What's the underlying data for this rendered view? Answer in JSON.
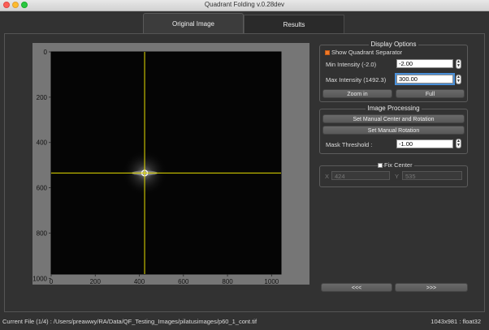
{
  "window": {
    "title": "Quadrant Folding v.0.28dev"
  },
  "tabs": [
    {
      "label": "Original Image",
      "active": true
    },
    {
      "label": "Results",
      "active": false
    }
  ],
  "display_options": {
    "title": "Display Options",
    "show_quadrant_separator": {
      "label": "Show Quadrant Separator",
      "checked": true
    },
    "min_intensity": {
      "label": "Min Intensity (-2.0)",
      "value": "-2.00"
    },
    "max_intensity": {
      "label": "Max Intensity (1492.3)",
      "value": "300.00"
    },
    "zoom_in_label": "Zoom in",
    "full_label": "Full"
  },
  "image_processing": {
    "title": "Image Processing",
    "set_center_rotation_label": "Set Manual Center and Rotation",
    "set_rotation_label": "Set Manual Rotation",
    "mask_threshold": {
      "label": "Mask Threshold :",
      "value": "-1.00"
    }
  },
  "fix_center": {
    "label": "Fix Center",
    "checked": false,
    "x_label": "X",
    "x_value": "424",
    "y_label": "Y",
    "y_value": "535"
  },
  "navigation": {
    "prev_label": "<<<",
    "next_label": ">>>"
  },
  "status": {
    "current_file": "Current File (1/4) : /Users/preawwy/RA/Data/QF_Testing_Images/pilatusimages/p60_1_cont.tif",
    "image_info": "1043x981 : float32"
  },
  "colors": {
    "separator_line": "#e8e000",
    "checkbox_checked": "#f07a2a",
    "focus_ring": "#4a90d9"
  },
  "image_plot": {
    "x_ticks": [
      0,
      200,
      400,
      600,
      800,
      1000
    ],
    "y_ticks": [
      0,
      200,
      400,
      600,
      800,
      1000
    ],
    "x_range": [
      0,
      1043
    ],
    "y_range": [
      0,
      981
    ],
    "center": {
      "x": 424,
      "y": 535
    }
  }
}
